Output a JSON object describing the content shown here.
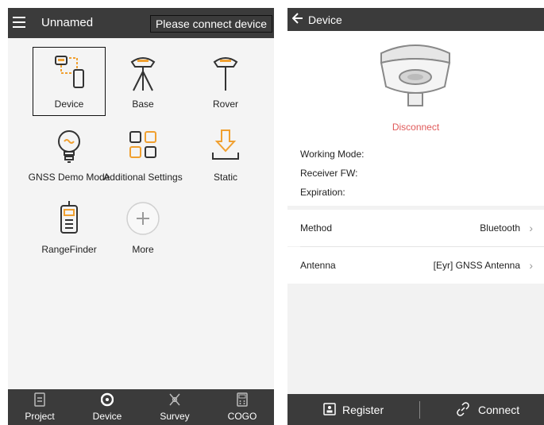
{
  "left": {
    "header": {
      "title": "Unnamed",
      "connect_banner": "Please connect device"
    },
    "tiles": {
      "device": "Device",
      "base": "Base",
      "rover": "Rover",
      "gnss_demo": "GNSS Demo Mode",
      "additional": "Additional Settings",
      "static": "Static",
      "rangefinder": "RangeFinder",
      "more": "More"
    },
    "nav": {
      "project": "Project",
      "device": "Device",
      "survey": "Survey",
      "cogo": "COGO"
    }
  },
  "right": {
    "header": {
      "title": "Device"
    },
    "status": "Disconnect",
    "info": {
      "working_mode": "Working Mode:",
      "receiver_fw": "Receiver FW:",
      "expiration": "Expiration:"
    },
    "method": {
      "label": "Method",
      "value": "Bluetooth"
    },
    "antenna": {
      "label": "Antenna",
      "value": "[Eyr] GNSS Antenna"
    },
    "bottom": {
      "register": "Register",
      "connect": "Connect"
    }
  },
  "colors": {
    "accent": "#f0a030",
    "dark_bar": "#3b3b3b",
    "status_red": "#e05a5a"
  }
}
